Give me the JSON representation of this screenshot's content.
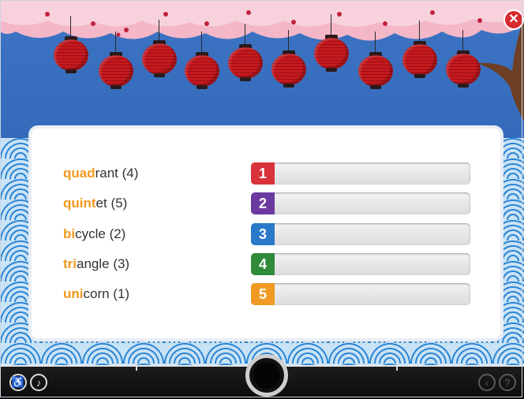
{
  "rows": [
    {
      "prefix": "quad",
      "rest": "rant (4)",
      "number": "1",
      "color": "#d8323a"
    },
    {
      "prefix": "quint",
      "rest": "et (5)",
      "number": "2",
      "color": "#6b3aa0"
    },
    {
      "prefix": "bi",
      "rest": "cycle (2)",
      "number": "3",
      "color": "#2a78c8"
    },
    {
      "prefix": "tri",
      "rest": "angle (3)",
      "number": "4",
      "color": "#2f8a3a"
    },
    {
      "prefix": "uni",
      "rest": "corn (1)",
      "number": "5",
      "color": "#ef9a22"
    }
  ],
  "toolbar": {
    "close_icon": "close-icon",
    "accessibility_icon": "person-icon",
    "audio_icon": "speaker-icon",
    "center_icon": "record-button-icon",
    "back_icon": "back-icon",
    "help_icon": "help-icon"
  }
}
